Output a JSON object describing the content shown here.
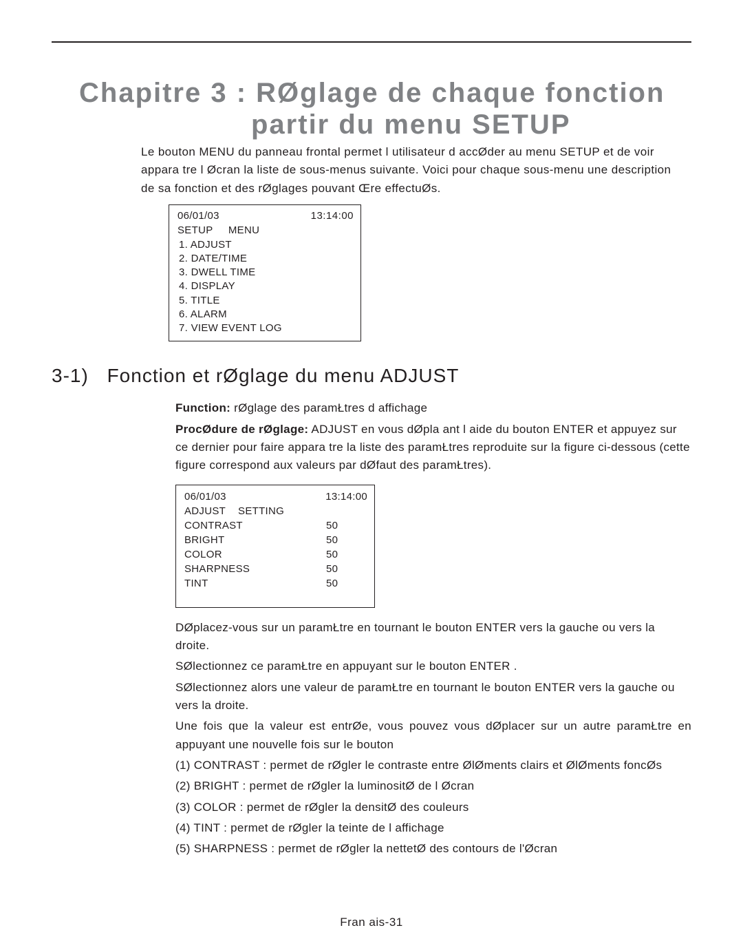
{
  "chapter": {
    "line1": "Chapitre 3 :   RØglage de chaque fonction",
    "line2": "partir du menu SETUP"
  },
  "intro": "Le bouton MENU du panneau frontal permet   l utilisateur d accØder au menu SETUP et de voir appara tre   l Øcran la liste de sous-menus suivante. Voici pour chaque sous-menu une description de sa fonction et des rØglages pouvant Œre effectuØs.",
  "osd1": {
    "date": "06/01/03",
    "time": "13:14:00",
    "title_a": "SETUP",
    "title_b": "MENU",
    "items": [
      "1. ADJUST",
      "2. DATE/TIME",
      "3. DWELL TIME",
      "4. DISPLAY",
      "5. TITLE",
      "6. ALARM",
      "7. VIEW EVENT LOG"
    ]
  },
  "section": {
    "num": "3-1)",
    "title": "Fonction et rØglage du menu ADJUST"
  },
  "func_label": "Function:",
  "func_text": " rØglage des paramŁtres d affichage",
  "proc_label": "Procédure de rØglage:",
  "proc_text": " ADJUST en vous dØpla ant   l aide du bouton   ENTER   et appuyez sur ce dernier pour faire appara tre la liste des paramŁtres reproduite sur la figure ci-dessous  (cette figure correspond aux valeurs par dØfaut des paramŁtres).",
  "proc_label_clean": "ProcØdure de rØglage:",
  "osd2": {
    "date": "06/01/03",
    "time": "13:14:00",
    "title_a": "ADJUST",
    "title_b": "SETTING",
    "rows": [
      {
        "label": "CONTRAST",
        "val": "50"
      },
      {
        "label": "BRIGHT",
        "val": "50"
      },
      {
        "label": "COLOR",
        "val": "50"
      },
      {
        "label": "SHARPNESS",
        "val": "50"
      },
      {
        "label": "TINT",
        "val": "50"
      }
    ]
  },
  "body2": [
    "DØplacez-vous sur un paramŁtre en tournant le bouton   ENTER   vers la gauche ou vers la droite.",
    "SØlectionnez ce paramŁtre en appuyant sur le bouton   ENTER  .",
    "SØlectionnez alors une valeur de paramŁtre en tournant le bouton   ENTER   vers la gauche ou vers la droite.",
    "Une fois que la valeur est entrØe, vous pouvez vous dØplacer sur un autre paramŁtre en appuyant une nouvelle fois sur le bouton",
    "(1) CONTRAST : permet de rØgler le contraste entre ØlØments clairs et ØlØments foncØs",
    "(2) BRIGHT : permet de rØgler la luminositØ de l Øcran",
    "(3) COLOR : permet de rØgler la densitØ des couleurs",
    "(4) TINT : permet de rØgler la teinte de l affichage",
    "(5) SHARPNESS : permet de rØgler la nettetØ des contours de l'Øcran"
  ],
  "page_num": "Fran ais-31"
}
